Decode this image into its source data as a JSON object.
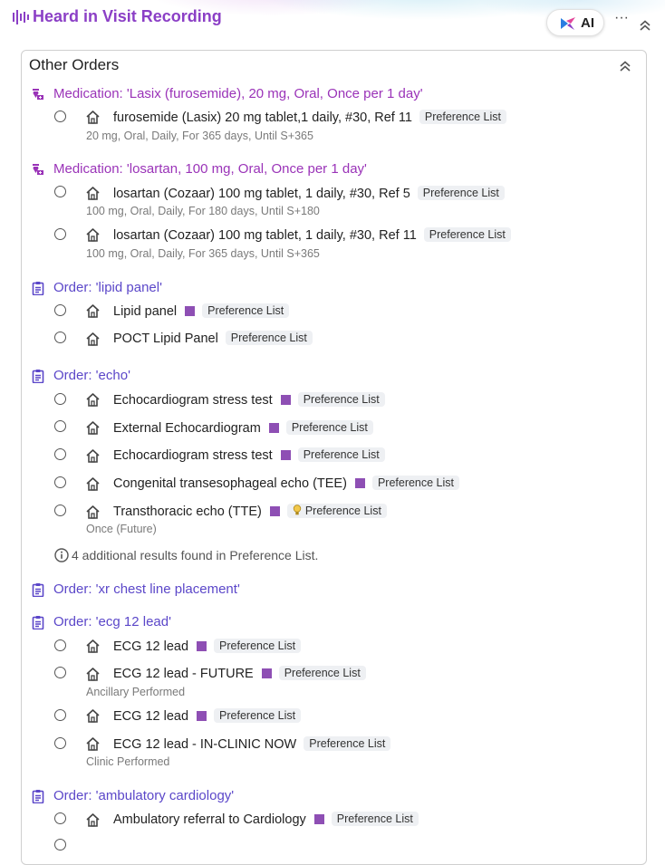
{
  "header": {
    "title": "Heard in Visit Recording",
    "ai_label": "AI",
    "more_label": "···"
  },
  "section": {
    "title": "Other Orders",
    "info_note": "4 additional results found in Preference List."
  },
  "colors": {
    "title_purple": "#8b3fc6",
    "medication_heading": "#9a33b8",
    "order_heading": "#5b47c9",
    "square_marker": "#8e4fb4",
    "badge_bg": "#eef0f3"
  },
  "groups": [
    {
      "type": "medication",
      "icon": "medication-icon",
      "label": "Medication: 'Lasix (furosemide), 20 mg, Oral, Once per 1 day'"
    },
    {
      "type": "medication",
      "icon": "medication-icon",
      "label": "Medication: 'losartan, 100 mg, Oral, Once per 1 day'"
    },
    {
      "type": "order",
      "icon": "clipboard-icon",
      "label": "Order: 'lipid panel'"
    },
    {
      "type": "order",
      "icon": "clipboard-icon",
      "label": "Order: 'echo'"
    },
    {
      "type": "order",
      "icon": "clipboard-icon",
      "label": "Order: 'xr chest line placement'"
    },
    {
      "type": "order",
      "icon": "clipboard-icon",
      "label": "Order: 'ecg 12 lead'"
    },
    {
      "type": "order",
      "icon": "clipboard-icon",
      "label": "Order: 'ambulatory cardiology'"
    }
  ],
  "items": [
    {
      "name": "furosemide (Lasix) 20 mg tablet,1 daily, #30, Ref 11",
      "badge": "Preference List",
      "detail": "20 mg, Oral, Daily, For 365 days, Until S+365"
    },
    {
      "name": "losartan (Cozaar) 100 mg tablet, 1 daily, #30, Ref 5",
      "badge": "Preference List",
      "detail": "100 mg, Oral, Daily, For 180 days, Until S+180"
    },
    {
      "name": "losartan (Cozaar) 100 mg tablet, 1 daily, #30, Ref 11",
      "badge": "Preference List",
      "detail": "100 mg, Oral, Daily, For 365 days, Until S+365"
    },
    {
      "name": "Lipid panel",
      "badge": "Preference List",
      "square": true
    },
    {
      "name": "POCT Lipid Panel",
      "badge": "Preference List"
    },
    {
      "name": "Echocardiogram stress test",
      "badge": "Preference List",
      "square": true
    },
    {
      "name": "External Echocardiogram",
      "badge": "Preference List",
      "square": true
    },
    {
      "name": "Echocardiogram stress test",
      "badge": "Preference List",
      "square": true
    },
    {
      "name": "Congenital transesophageal echo (TEE)",
      "badge": "Preference List",
      "square": true
    },
    {
      "name": "Transthoracic echo (TTE)",
      "badge": "Preference List",
      "square": true,
      "badge_icon": "lightbulb-icon",
      "detail": "Once (Future)"
    },
    {
      "name": "ECG 12 lead",
      "badge": "Preference List",
      "square": true
    },
    {
      "name": "ECG 12 lead - FUTURE",
      "badge": "Preference List",
      "square": true,
      "detail": "Ancillary Performed"
    },
    {
      "name": "ECG 12 lead",
      "badge": "Preference List",
      "square": true
    },
    {
      "name": "ECG 12 lead - IN-CLINIC NOW",
      "badge": "Preference List",
      "detail": "Clinic Performed"
    },
    {
      "name": "Ambulatory referral to Cardiology",
      "badge": "Preference List",
      "square": true
    }
  ]
}
